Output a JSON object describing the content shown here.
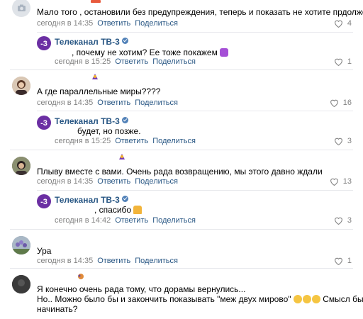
{
  "comments": [
    {
      "text": "Мало того , остановили без предупреждения, теперь и показать не хотите прдолжения",
      "time": "сегодня в 14:35",
      "reply": "Ответить",
      "share": "Поделиться",
      "likes": "4"
    },
    {
      "author": "Телеканал ТВ-3",
      "text": ", почему не хотим? Ее тоже покажем",
      "time": "сегодня в 15:25",
      "reply": "Ответить",
      "share": "Поделиться",
      "likes": "1"
    },
    {
      "text": "А где параллельные миры????",
      "time": "сегодня в 14:35",
      "reply": "Ответить",
      "share": "Поделиться",
      "likes": "16"
    },
    {
      "author": "Телеканал ТВ-3",
      "text": "будет, но позже.",
      "time": "сегодня в 15:25",
      "reply": "Ответить",
      "share": "Поделиться",
      "likes": "3"
    },
    {
      "text": "Плыву вместе с вами. Очень рада возвращению, мы этого давно ждали",
      "time": "сегодня в 14:35",
      "reply": "Ответить",
      "share": "Поделиться",
      "likes": "13"
    },
    {
      "author": "Телеканал ТВ-3",
      "text": ", спасибо",
      "time": "сегодня в 14:42",
      "reply": "Ответить",
      "share": "Поделиться",
      "likes": "3"
    },
    {
      "text": "Ура",
      "time": "сегодня в 14:35",
      "reply": "Ответить",
      "share": "Поделиться",
      "likes": "1"
    },
    {
      "text_line1": "Я конечно очень рада тому, что дорамы вернулись...",
      "text_line2": "Но.. Можно было бы и закончить показывать \"меж двух мирово\"",
      "text_line2b": "Смысл был",
      "text_line3": "начинать?"
    }
  ],
  "colors": {
    "link": "#2a5885",
    "meta": "#828282",
    "tv3": "#6b2fa3"
  }
}
